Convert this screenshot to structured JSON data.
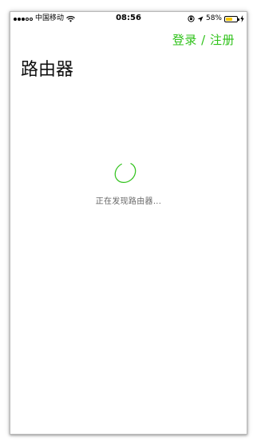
{
  "status_bar": {
    "signal_dots_filled": 3,
    "signal_dots_total": 5,
    "carrier": "中国移动",
    "time": "08:56",
    "battery_percent": "58%",
    "battery_level": 0.58,
    "icons": [
      "wifi-icon",
      "rotation-lock-icon",
      "location-arrow-icon",
      "battery-icon",
      "charging-bolt-icon"
    ]
  },
  "nav": {
    "login_register": "登录 / 注册"
  },
  "page": {
    "title": "路由器"
  },
  "loading": {
    "text": "正在发现路由器..."
  },
  "colors": {
    "accent": "#2fc21a",
    "battery": "#f7c600"
  }
}
